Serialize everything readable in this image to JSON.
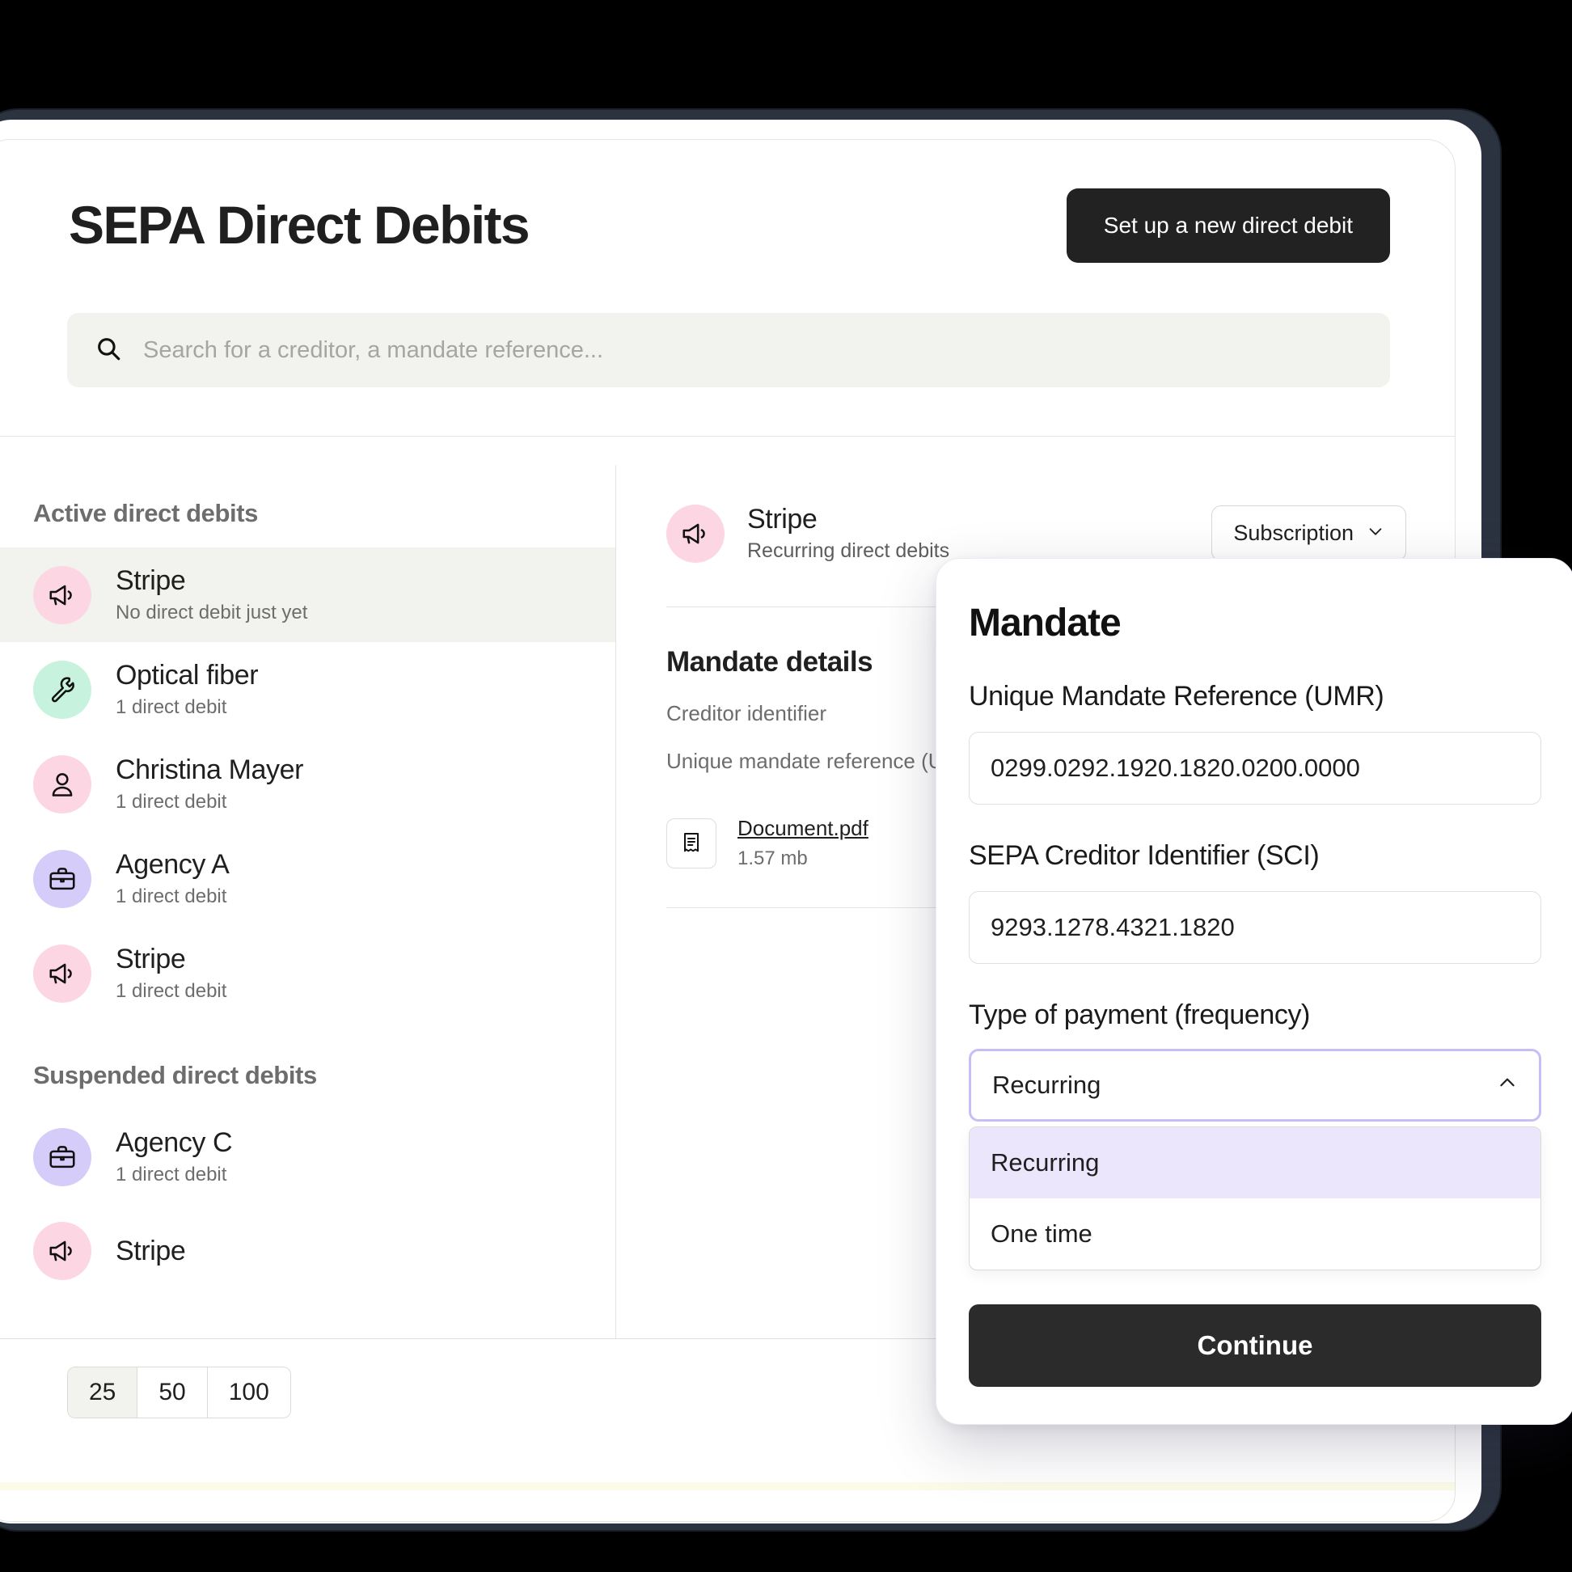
{
  "header": {
    "title": "SEPA Direct Debits",
    "primary_button": "Set up a new direct debit"
  },
  "search": {
    "placeholder": "Search for a creditor, a mandate reference...",
    "value": ""
  },
  "sidebar": {
    "active_section_label": "Active direct debits",
    "suspended_section_label": "Suspended direct debits",
    "active_items": [
      {
        "name": "Stripe",
        "sub": "No direct debit just yet",
        "icon": "megaphone-icon",
        "avatar_color": "#fcd6e2",
        "selected": true
      },
      {
        "name": "Optical fiber",
        "sub": "1 direct debit",
        "icon": "wrench-icon",
        "avatar_color": "#c7f2de",
        "selected": false
      },
      {
        "name": "Christina Mayer",
        "sub": "1 direct debit",
        "icon": "person-icon",
        "avatar_color": "#fcd6e2",
        "selected": false
      },
      {
        "name": "Agency A",
        "sub": "1 direct debit",
        "icon": "briefcase-icon",
        "avatar_color": "#d5ccfa",
        "selected": false
      },
      {
        "name": "Stripe",
        "sub": "1 direct debit",
        "icon": "megaphone-icon",
        "avatar_color": "#fcd6e2",
        "selected": false
      }
    ],
    "suspended_items": [
      {
        "name": "Agency C",
        "sub": "1 direct debit",
        "icon": "briefcase-icon",
        "avatar_color": "#d5ccfa",
        "selected": false
      },
      {
        "name": "Stripe",
        "sub": "",
        "icon": "megaphone-icon",
        "avatar_color": "#fcd6e2",
        "selected": false
      }
    ]
  },
  "pagination": {
    "options": [
      "25",
      "50",
      "100"
    ],
    "selected": "25"
  },
  "detail": {
    "creditor_name": "Stripe",
    "creditor_sub": "Recurring direct debits",
    "type_select_value": "Subscription",
    "section_title": "Mandate details",
    "field_creditor_identifier": "Creditor identifier",
    "field_unique_mandate_reference": "Unique mandate reference (UMR)",
    "document": {
      "name": "Document.pdf",
      "size": "1.57 mb"
    }
  },
  "modal": {
    "title": "Mandate",
    "umr_label": "Unique Mandate Reference (UMR)",
    "umr_value": "0299.0292.1920.1820.0200.0000",
    "sci_label": "SEPA Creditor Identifier (SCI)",
    "sci_value": "9293.1278.4321.1820",
    "frequency_label": "Type of payment (frequency)",
    "frequency_value": "Recurring",
    "frequency_options": [
      "Recurring",
      "One time"
    ],
    "frequency_selected_index": 0,
    "continue_label": "Continue",
    "accent_color": "#c9bdf7",
    "highlight_color": "#ebe6fb"
  }
}
